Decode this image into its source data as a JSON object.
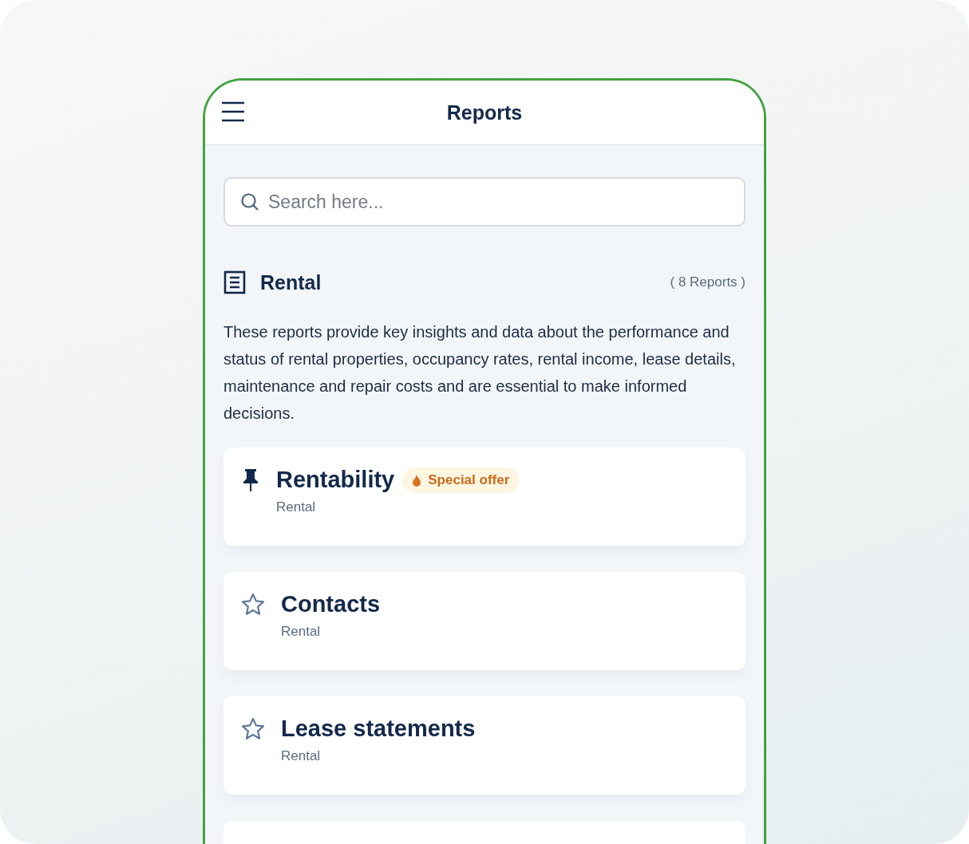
{
  "header": {
    "title": "Reports"
  },
  "search": {
    "placeholder": "Search here..."
  },
  "section": {
    "title": "Rental",
    "count": "( 8 Reports )",
    "description": "These reports provide key insights and data about the performance and status of rental properties, occupancy rates, rental income, lease details, maintenance and repair costs and are essential to make informed decisions."
  },
  "reports": [
    {
      "kind": "pinned",
      "title": "Rentability",
      "badge": "Special offer",
      "category": "Rental"
    },
    {
      "kind": "star",
      "title": "Contacts",
      "category": "Rental"
    },
    {
      "kind": "star",
      "title": "Lease statements",
      "category": "Rental"
    }
  ]
}
